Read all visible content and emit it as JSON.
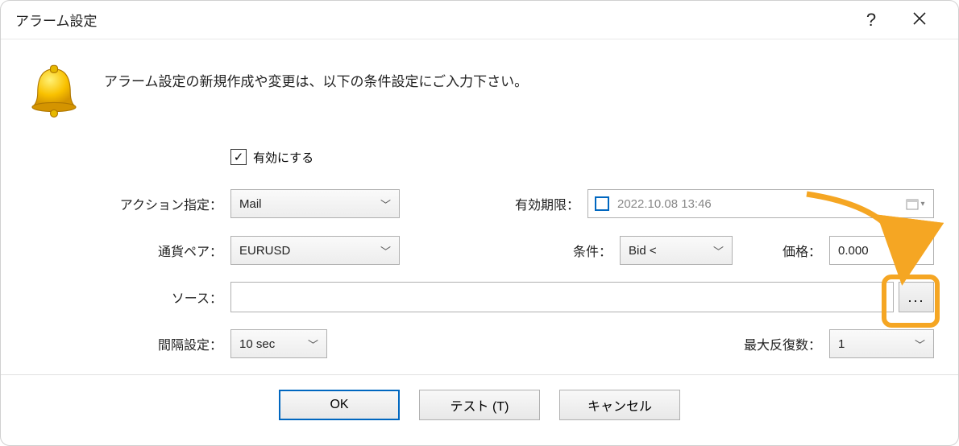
{
  "window": {
    "title": "アラーム設定"
  },
  "intro": "アラーム設定の新規作成や変更は、以下の条件設定にご入力下さい。",
  "form": {
    "enable_label": "有効にする",
    "enable_checked": true,
    "action_label": "アクション指定：",
    "action_value": "Mail",
    "expiry_label": "有効期限：",
    "expiry_value": "2022.10.08 13:46",
    "pair_label": "通貨ペア：",
    "pair_value": "EURUSD",
    "condition_label": "条件：",
    "condition_value": "Bid <",
    "price_label": "価格：",
    "price_value": "0.000",
    "source_label": "ソース：",
    "source_value": "",
    "browse_label": "...",
    "interval_label": "間隔設定：",
    "interval_value": "10 sec",
    "max_label": "最大反復数：",
    "max_value": "1"
  },
  "buttons": {
    "ok": "OK",
    "test": "テスト (T)",
    "cancel": "キャンセル"
  }
}
